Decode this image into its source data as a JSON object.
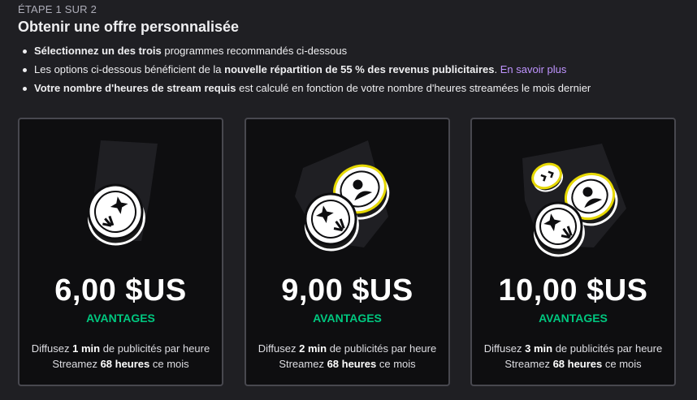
{
  "header": {
    "step": "ÉTAPE 1 SUR 2",
    "title": "Obtenir une offre personnalisée"
  },
  "bullets": [
    {
      "bold": "Sélectionnez un des trois",
      "text": " programmes recommandés ci-dessous"
    },
    {
      "pre": "Les options ci-dessous bénéficient de la ",
      "bold": "nouvelle répartition de 55 % des revenus publicitaires",
      "post": ". ",
      "link": "En savoir plus"
    },
    {
      "bold": "Votre nombre d'heures de stream requis",
      "text": " est calculé en fonction de votre nombre d'heures streamées le mois dernier"
    }
  ],
  "cards": [
    {
      "price": "6,00 $US",
      "perks": "AVANTAGES",
      "line1_pre": "Diffusez ",
      "line1_bold": "1 min",
      "line1_post": " de publicités par heure",
      "line2_pre": "Streamez ",
      "line2_bold": "68 heures",
      "line2_post": " ce mois",
      "icon": "single-coin-icon"
    },
    {
      "price": "9,00 $US",
      "perks": "AVANTAGES",
      "line1_pre": "Diffusez ",
      "line1_bold": "2 min",
      "line1_post": " de publicités par heure",
      "line2_pre": "Streamez ",
      "line2_bold": "68 heures",
      "line2_post": " ce mois",
      "icon": "two-coins-icon"
    },
    {
      "price": "10,00 $US",
      "perks": "AVANTAGES",
      "line1_pre": "Diffusez ",
      "line1_bold": "3 min",
      "line1_post": " de publicités par heure",
      "line2_pre": "Streamez ",
      "line2_bold": "68 heures",
      "line2_post": " ce mois",
      "icon": "three-coins-icon"
    }
  ],
  "colors": {
    "background": "#1f1f23",
    "card": "#0e0e10",
    "card_border": "#48484f",
    "accent_green": "#00c77f",
    "link": "#bf94ff",
    "coin_ring": "#e6d800"
  }
}
